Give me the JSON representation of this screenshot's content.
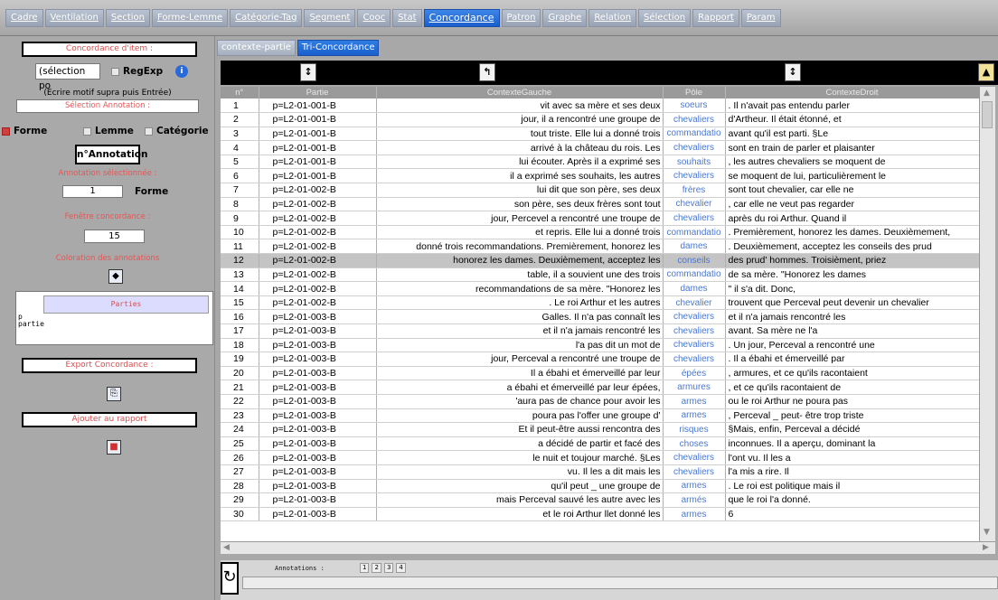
{
  "tabs": [
    "Cadre",
    "Ventilation",
    "Section",
    "Forme-Lemme",
    "Catégorie-Tag",
    "Segment",
    "Cooc",
    "Stat",
    "Concordance",
    "Patron",
    "Graphe",
    "Relation",
    "Sélection",
    "Rapport",
    "Param"
  ],
  "active_tab": "Concordance",
  "left": {
    "concordance_title": "Concordance d'item :",
    "search_value": "(sélection po",
    "regexp_label": "RegExp",
    "hint": "(Ecrire motif supra puis Entrée)",
    "selection_annotation": "Sélection Annotation :",
    "forme_label": "Forme",
    "lemme_label": "Lemme",
    "categorie_label": "Catégorie",
    "nannotation_label": "n°Annotation",
    "annotation_selected_label": "Annotation sélectionnée :",
    "annotation_value": "1",
    "annotation_type": "Forme",
    "window_label": "Fenêtre concordance :",
    "window_value": "15",
    "coloration_label": "Coloration des annotations",
    "parties_header": "Parties",
    "parties_rows": [
      "p",
      "partie"
    ],
    "export_label": "Export Concordance :",
    "rapport_label": "Ajouter au rapport"
  },
  "subtabs": [
    "contexte-partie",
    "Tri-Concordance"
  ],
  "active_subtab": "Tri-Concordance",
  "table": {
    "headers": [
      "n°",
      "Partie",
      "ContexteGauche",
      "Pôle",
      "ContexteDroit"
    ],
    "selected_row": 12,
    "rows": [
      [
        "1",
        "p=L2-01-001-B",
        "vit avec sa mère et ses deux",
        "soeurs",
        ". Il n'avait pas entendu parler"
      ],
      [
        "2",
        "p=L2-01-001-B",
        "jour, il a rencontré une groupe de",
        "chevaliers",
        "d'Artheur. Il était étonné, et"
      ],
      [
        "3",
        "p=L2-01-001-B",
        "tout triste. Elle lui a donné trois",
        "commandatio",
        "avant qu'il est parti. §Le"
      ],
      [
        "4",
        "p=L2-01-001-B",
        "arrivé à la château du rois. Les",
        "chevaliers",
        "sont en train de parler et plaisanter"
      ],
      [
        "5",
        "p=L2-01-001-B",
        "lui écouter. Après il a exprimé ses",
        "souhaits",
        ", les autres chevaliers se moquent de"
      ],
      [
        "6",
        "p=L2-01-001-B",
        "il a exprimé ses souhaits, les autres",
        "chevaliers",
        "se moquent de lui, particulièrement le"
      ],
      [
        "7",
        "p=L2-01-002-B",
        "lui dit que son père, ses deux",
        "frères",
        "sont tout chevalier, car elle ne"
      ],
      [
        "8",
        "p=L2-01-002-B",
        "son père, ses deux frères sont tout",
        "chevalier",
        ", car elle ne veut pas regarder"
      ],
      [
        "9",
        "p=L2-01-002-B",
        "jour, Percevel a rencontré une troupe de",
        "chevaliers",
        "après du roi Arthur. Quand il"
      ],
      [
        "10",
        "p=L2-01-002-B",
        "et repris. Elle lui a donné trois",
        "commandatio",
        ". Premièrement, honorez les dames. Deuxièmement,"
      ],
      [
        "11",
        "p=L2-01-002-B",
        "donné trois recommandations. Premièrement, honorez les",
        "dames",
        ". Deuxièmement, acceptez les conseils des prud"
      ],
      [
        "12",
        "p=L2-01-002-B",
        "honorez les dames. Deuxièmement, acceptez les",
        "conseils",
        "des prud' hommes. Troisièment, priez"
      ],
      [
        "13",
        "p=L2-01-002-B",
        "table, il a souvient une des trois",
        "commandatio",
        "de sa mère. \"Honorez les dames"
      ],
      [
        "14",
        "p=L2-01-002-B",
        "recommandations de sa mère. \"Honorez les",
        "dames",
        "\" il s'a dit. Donc,"
      ],
      [
        "15",
        "p=L2-01-002-B",
        ". Le roi Arthur et les autres",
        "chevalier",
        "trouvent que Perceval peut devenir un chevalier"
      ],
      [
        "16",
        "p=L2-01-003-B",
        "Galles. Il n'a pas connaît les",
        "chevaliers",
        "et il n'a jamais rencontré les"
      ],
      [
        "17",
        "p=L2-01-003-B",
        "et il n'a jamais rencontré les",
        "chevaliers",
        "avant. Sa mère ne l'a"
      ],
      [
        "18",
        "p=L2-01-003-B",
        "l'a pas dit un mot de",
        "chevaliers",
        ". Un jour, Perceval a rencontré une"
      ],
      [
        "19",
        "p=L2-01-003-B",
        "jour, Perceval a rencontré une troupe de",
        "chevaliers",
        ". Il a ébahi et émerveillé par"
      ],
      [
        "20",
        "p=L2-01-003-B",
        "Il a ébahi et émerveillé par leur",
        "épées",
        ", armures, et ce qu'ils racontaient"
      ],
      [
        "21",
        "p=L2-01-003-B",
        "a ébahi et émerveillé par leur épées,",
        "armures",
        ", et ce qu'ils racontaient de"
      ],
      [
        "22",
        "p=L2-01-003-B",
        "'aura pas de chance pour avoir les",
        "armes",
        "ou le roi Arthur ne poura pas"
      ],
      [
        "23",
        "p=L2-01-003-B",
        "poura pas l'offer une groupe d'",
        "armes",
        ", Perceval _ peut- être trop triste"
      ],
      [
        "24",
        "p=L2-01-003-B",
        "Et il peut-être aussi rencontra des",
        "risques",
        "§Mais, enfin, Perceval a décidé"
      ],
      [
        "25",
        "p=L2-01-003-B",
        "a décidé de partir et facé des",
        "choses",
        "inconnues. Il a aperçu, dominant la"
      ],
      [
        "26",
        "p=L2-01-003-B",
        "le nuit et toujour marché. §Les",
        "chevaliers",
        "l'ont vu. Il les a"
      ],
      [
        "27",
        "p=L2-01-003-B",
        "vu. Il les a dit mais les",
        "chevaliers",
        "l'a mis a rire. Il"
      ],
      [
        "28",
        "p=L2-01-003-B",
        "qu'il peut _ une groupe de",
        "armes",
        ". Le roi est politique mais il"
      ],
      [
        "29",
        "p=L2-01-003-B",
        "mais Perceval sauvé les autre avec les",
        "armés",
        "que le roi l'a donné."
      ],
      [
        "30",
        "p=L2-01-003-B",
        "et le roi Arthur llet donné les",
        "armes",
        "6"
      ]
    ]
  },
  "bottom": {
    "annotations_label": "Annotations :",
    "annotation_buttons": [
      "1",
      "2",
      "3",
      "4"
    ]
  }
}
